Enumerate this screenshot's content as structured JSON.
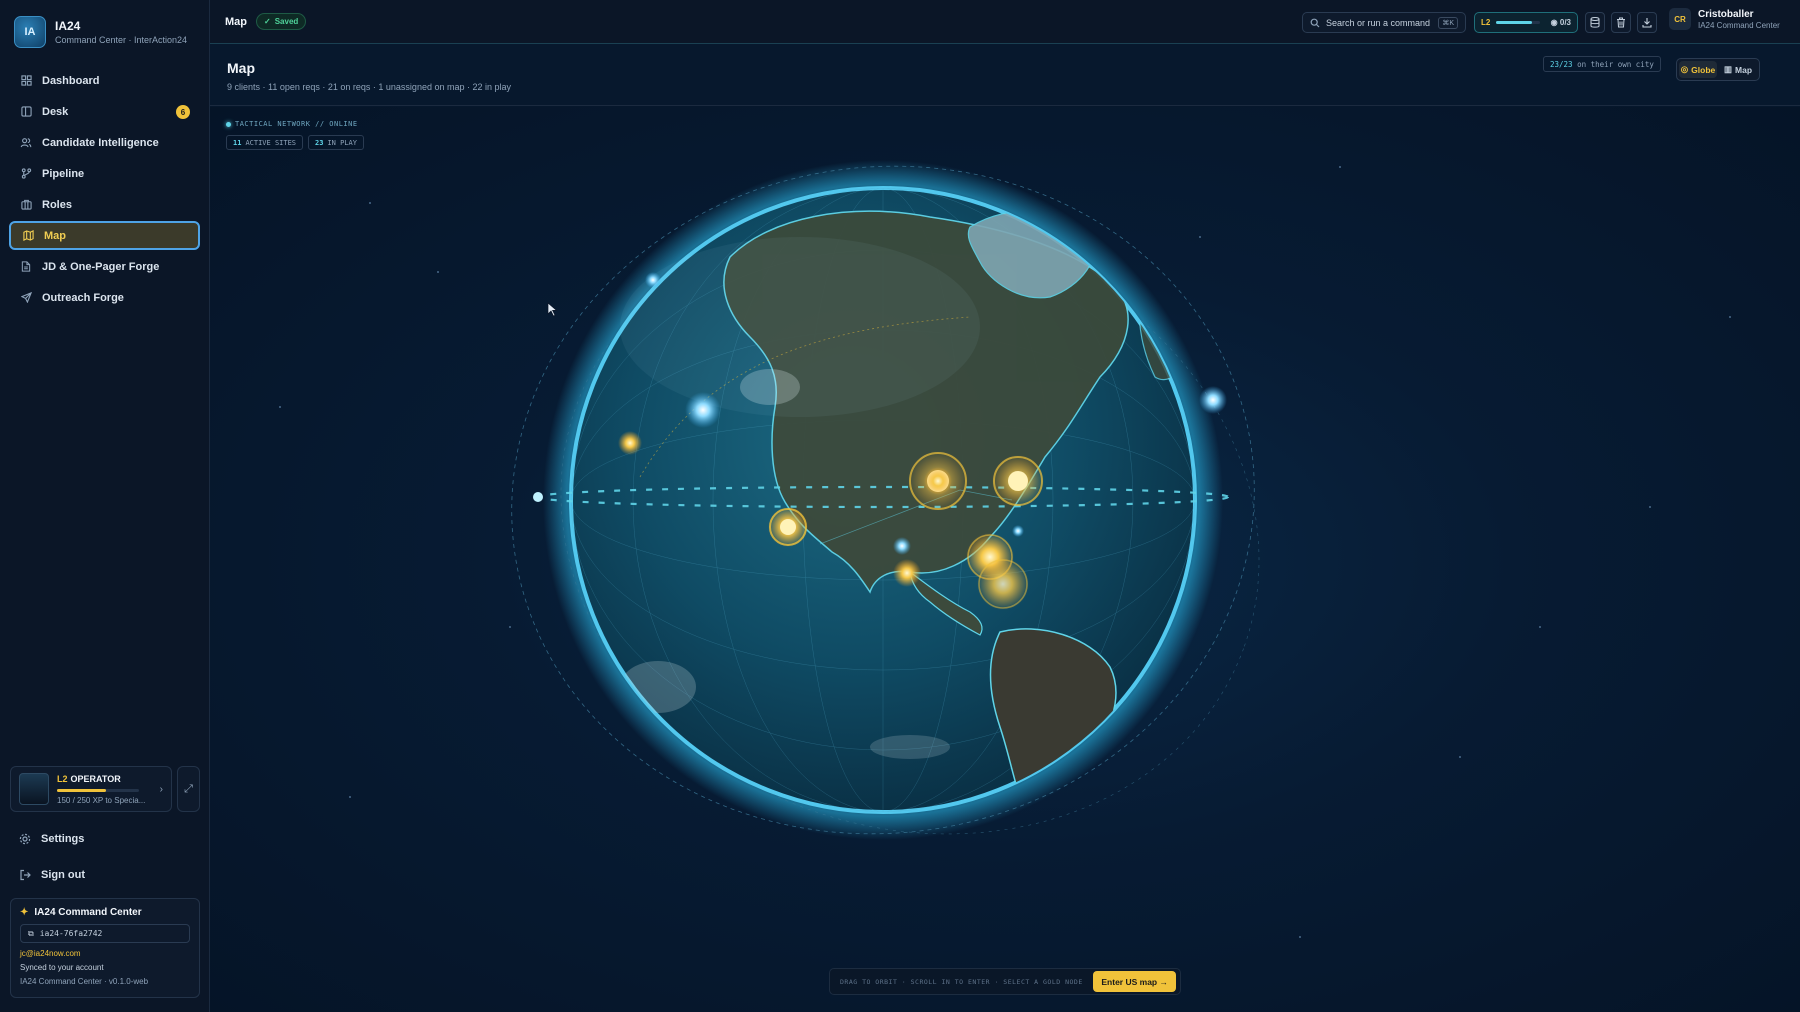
{
  "brand": {
    "logo_text": "IA",
    "name": "IA24",
    "subtitle": "Command Center · InterAction24"
  },
  "sidebar": {
    "items": [
      {
        "label": "Dashboard",
        "icon": "dashboard-icon"
      },
      {
        "label": "Desk",
        "icon": "desk-icon",
        "badge": "6"
      },
      {
        "label": "Candidate Intelligence",
        "icon": "users-icon"
      },
      {
        "label": "Pipeline",
        "icon": "pipeline-icon"
      },
      {
        "label": "Roles",
        "icon": "briefcase-icon"
      },
      {
        "label": "Map",
        "icon": "map-icon",
        "active": true
      },
      {
        "label": "JD & One-Pager Forge",
        "icon": "document-icon"
      },
      {
        "label": "Outreach Forge",
        "icon": "send-icon"
      }
    ],
    "operator": {
      "level": "L2",
      "title": "OPERATOR",
      "xp_text": "150 / 250 XP to Specia...",
      "xp_fraction": 0.6
    },
    "settings_label": "Settings",
    "signout_label": "Sign out",
    "account": {
      "title": "IA24 Command Center",
      "id": "ia24-76fa2742",
      "email": "jc@ia24now.com",
      "sync_text": "Synced to your account",
      "version": "IA24 Command Center · v0.1.0-web"
    }
  },
  "topbar": {
    "title": "Map",
    "saved_label": "Saved",
    "search_placeholder": "Search or run a command",
    "search_shortcut": "⌘K",
    "level": "L2",
    "level_fraction": 0.8,
    "quests": "0/3",
    "user": {
      "initials": "CR",
      "name": "Cristoballer",
      "subtitle": "IA24 Command Center"
    }
  },
  "page": {
    "title": "Map",
    "subtitle": "9 clients · 11 open reqs · 21 on reqs · 1 unassigned on map · 22 in play",
    "cities_count": "23/23",
    "cities_label": "on their own city",
    "view_globe": "Globe",
    "view_map": "Map"
  },
  "globe": {
    "status": "TACTICAL NETWORK // ONLINE",
    "active_sites_count": "11",
    "active_sites_label": "ACTIVE SITES",
    "in_play_count": "23",
    "in_play_label": "IN PLAY",
    "hint": "DRAG TO ORBIT · SCROLL IN TO ENTER · SELECT A GOLD NODE",
    "enter_label": "Enter US map →"
  },
  "colors": {
    "accent_gold": "#f0c23a",
    "accent_cyan": "#5fd4e8",
    "background": "#06172c",
    "sidebar": "#0b1627"
  }
}
